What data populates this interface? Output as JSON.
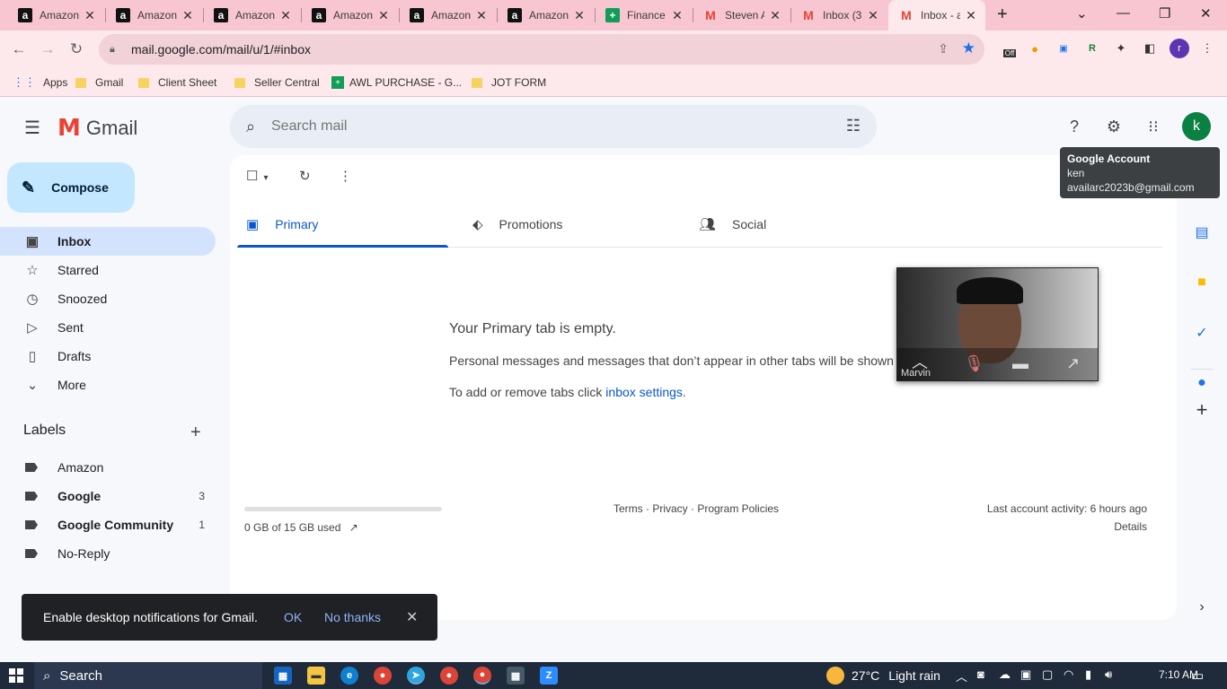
{
  "browser": {
    "tabs": [
      {
        "title": "Amazon",
        "favicon": "amazon-icon"
      },
      {
        "title": "Amazon",
        "favicon": "amazon-icon"
      },
      {
        "title": "Amazon",
        "favicon": "amazon-icon"
      },
      {
        "title": "Amazon",
        "favicon": "amazon-icon"
      },
      {
        "title": "Amazon",
        "favicon": "amazon-icon"
      },
      {
        "title": "Amazon",
        "favicon": "amazon-icon"
      },
      {
        "title": "Finance",
        "favicon": "sheets-icon"
      },
      {
        "title": "Steven A",
        "favicon": "gmail-icon"
      },
      {
        "title": "Inbox (3",
        "favicon": "gmail-icon"
      },
      {
        "title": "Inbox - a",
        "favicon": "gmail-icon",
        "active": true
      }
    ],
    "url": "mail.google.com/mail/u/1/#inbox",
    "bookmarks": [
      {
        "label": "Apps"
      },
      {
        "label": "Gmail"
      },
      {
        "label": "Client Sheet"
      },
      {
        "label": "Seller Central"
      },
      {
        "label": "AWL PURCHASE - G..."
      },
      {
        "label": "JOT FORM"
      }
    ],
    "extension_badge": "Off",
    "profile_initial": "r",
    "tab_strip_color": "#f7c6d0"
  },
  "gmail": {
    "logo_text": "Gmail",
    "search_placeholder": "Search mail",
    "avatar_initial": "k",
    "tooltip": {
      "title": "Google Account",
      "name": "ken",
      "email": "availarc2023b@gmail.com"
    },
    "compose_label": "Compose",
    "nav": [
      {
        "label": "Inbox",
        "icon": "inbox-icon",
        "active": true
      },
      {
        "label": "Starred",
        "icon": "star-icon"
      },
      {
        "label": "Snoozed",
        "icon": "clock-icon"
      },
      {
        "label": "Sent",
        "icon": "send-icon"
      },
      {
        "label": "Drafts",
        "icon": "draft-icon"
      },
      {
        "label": "More",
        "icon": "chevron-down-icon"
      }
    ],
    "labels_heading": "Labels",
    "labels": [
      {
        "name": "Amazon",
        "count": "",
        "bold": false
      },
      {
        "name": "Google",
        "count": "3",
        "bold": true
      },
      {
        "name": "Google Community",
        "count": "1",
        "bold": true
      },
      {
        "name": "No-Reply",
        "count": "",
        "bold": false
      }
    ],
    "tabs": [
      {
        "label": "Primary",
        "icon": "inbox-icon",
        "active": true
      },
      {
        "label": "Promotions",
        "icon": "tag-icon"
      },
      {
        "label": "Social",
        "icon": "people-icon"
      }
    ],
    "empty_state": {
      "title": "Your Primary tab is empty.",
      "body": "Personal messages and messages that don’t appear in other tabs will be shown here.",
      "hint_prefix": "To add or remove tabs click ",
      "hint_link": "inbox settings",
      "hint_suffix": "."
    },
    "storage": "0 GB of 15 GB used",
    "storage_fraction": 0.0,
    "footer_links": "Terms · Privacy · Program Policies",
    "last_activity": "Last account activity: 6 hours ago",
    "details_link": "Details",
    "accent_color": "#0b57d0"
  },
  "video_call": {
    "participant_name": "Marvin"
  },
  "snackbar": {
    "message": "Enable desktop notifications for Gmail.",
    "ok": "OK",
    "no_thanks": "No thanks"
  },
  "taskbar": {
    "search_label": "Search",
    "weather_temp": "27°C",
    "weather_desc": "Light rain",
    "time": "7:10 AM"
  }
}
